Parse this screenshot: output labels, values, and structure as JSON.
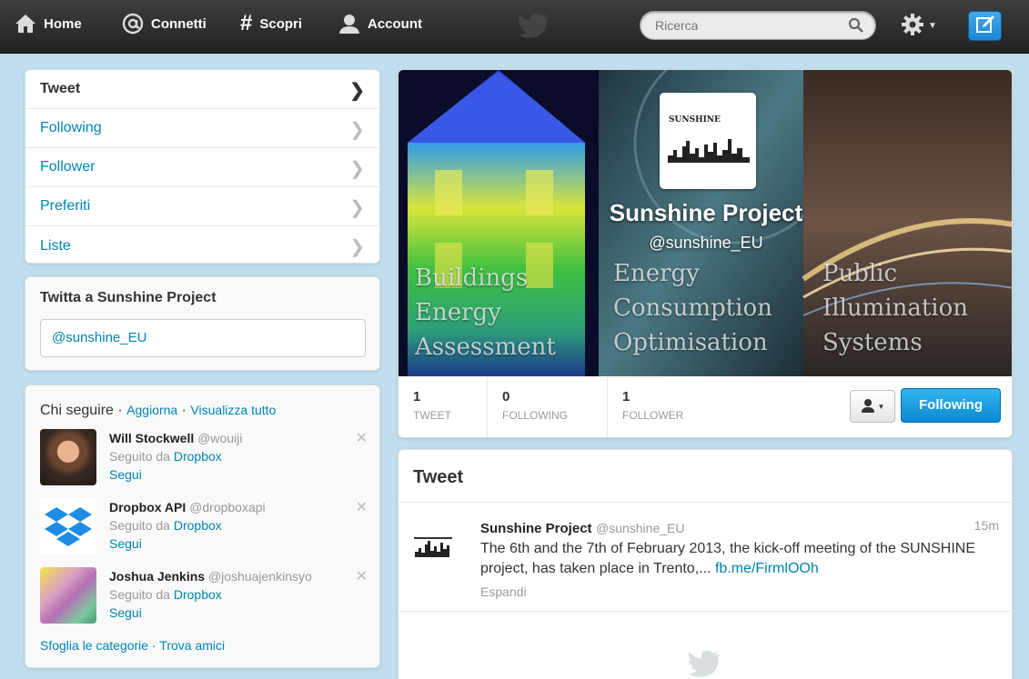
{
  "topbar": {
    "home": "Home",
    "connect": "Connetti",
    "discover": "Scopri",
    "account": "Account",
    "search_placeholder": "Ricerca"
  },
  "sidebar": {
    "items": [
      {
        "label": "Tweet"
      },
      {
        "label": "Following"
      },
      {
        "label": "Follower"
      },
      {
        "label": "Preferiti"
      },
      {
        "label": "Liste"
      }
    ]
  },
  "tweet_to": {
    "title": "Twitta a Sunshine Project",
    "value": "@sunshine_EU"
  },
  "who_to_follow": {
    "title": "Chi seguire",
    "refresh": "Aggiorna",
    "view_all": "Visualizza tutto",
    "followed_by_label": "Seguito da",
    "follow_label": "Segui",
    "users": [
      {
        "name": "Will Stockwell",
        "handle": "@wouiji",
        "followed_by": "Dropbox"
      },
      {
        "name": "Dropbox API",
        "handle": "@dropboxapi",
        "followed_by": "Dropbox"
      },
      {
        "name": "Joshua Jenkins",
        "handle": "@joshuajenkinsyo",
        "followed_by": "Dropbox"
      }
    ],
    "browse": "Sfoglia le categorie",
    "find_friends": "Trova amici"
  },
  "profile": {
    "name": "Sunshine Project",
    "handle": "@sunshine_EU",
    "logo_title": "SUNSHINE",
    "captions": [
      {
        "lines": [
          "Buildings",
          "Energy",
          "Assessment"
        ]
      },
      {
        "lines": [
          "Energy",
          "Consumption",
          "Optimisation"
        ]
      },
      {
        "lines": [
          "Public",
          "Illumination",
          "Systems"
        ]
      }
    ],
    "stats": [
      {
        "value": "1",
        "label": "TWEET"
      },
      {
        "value": "0",
        "label": "FOLLOWING"
      },
      {
        "value": "1",
        "label": "FOLLOWER"
      }
    ],
    "follow_button": "Following"
  },
  "tweets": {
    "title": "Tweet",
    "items": [
      {
        "name": "Sunshine Project",
        "handle": "@sunshine_EU",
        "time": "15m",
        "text": "The 6th and the 7th of February 2013, the kick-off meeting of the SUNSHINE project, has taken place in Trento,...",
        "link": "fb.me/FirmlOOh",
        "expand": "Espandi"
      }
    ]
  },
  "colors": {
    "background": "#c0deed",
    "link": "#0084b4",
    "topbar": "#2b2b2b",
    "button": "#1b95e0"
  },
  "icons": [
    "home-icon",
    "at-icon",
    "hash-icon",
    "person-icon",
    "twitter-bird-icon",
    "search-icon",
    "gear-icon",
    "compose-icon",
    "chevron-right-icon",
    "close-icon",
    "user-dropdown-icon"
  ]
}
